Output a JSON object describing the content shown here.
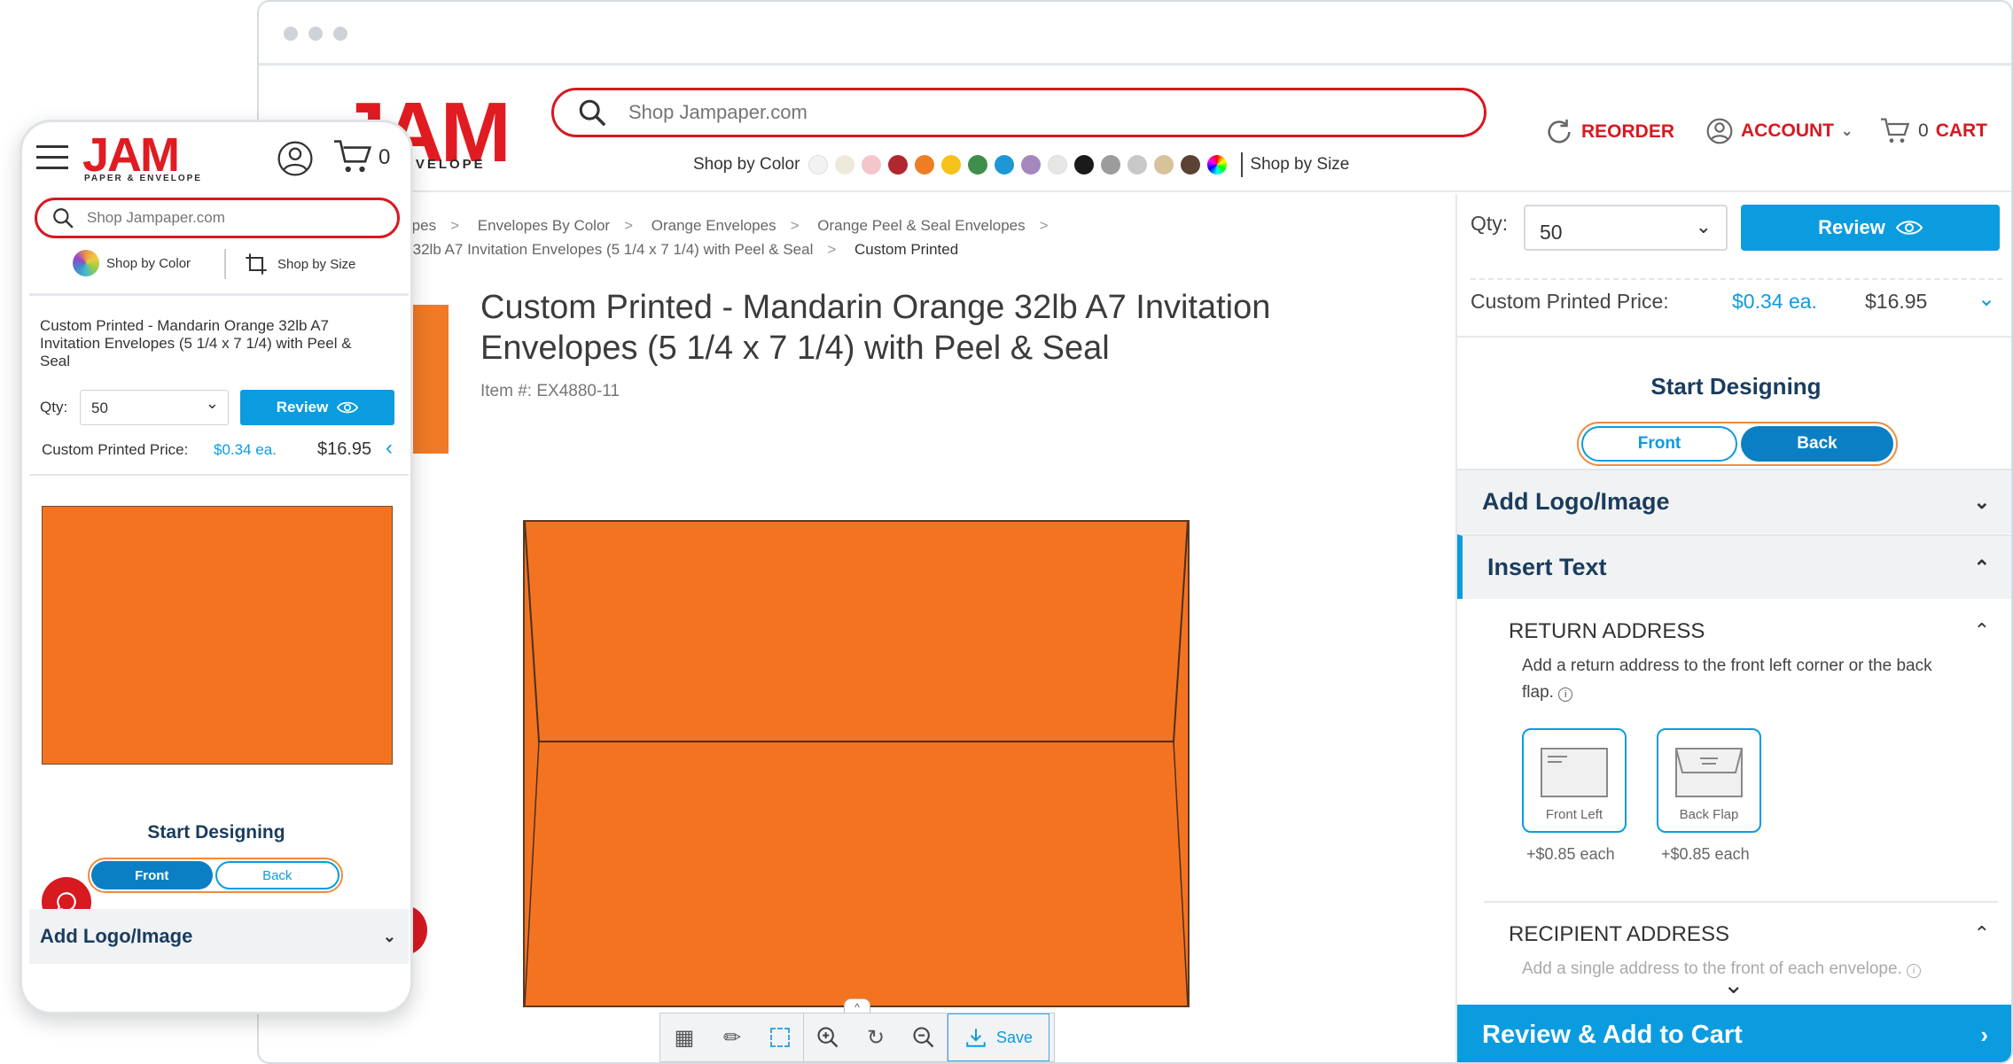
{
  "desktop": {
    "header": {
      "logo_main": "JAM",
      "logo_sub": "ENVELOPE",
      "search_placeholder": "Shop Jampaper.com",
      "shop_by_color": "Shop by Color",
      "shop_by_size": "Shop by Size",
      "swatches": [
        "#f2f2f2",
        "#eeeadb",
        "#f4c5cb",
        "#b0272f",
        "#ee7d26",
        "#f5c21b",
        "#3e8e4c",
        "#1f97d4",
        "#a487bf",
        "#e6e6e6",
        "#1a1a1a",
        "#9c9c9c",
        "#c8c8c8",
        "#d7c39a",
        "#5b4234"
      ],
      "reorder": "REORDER",
      "account": "ACCOUNT",
      "cart_count": "0",
      "cart": "CART"
    },
    "breadcrumb": [
      "elopes",
      "Envelopes By Color",
      "Orange Envelopes",
      "Orange Peel & Seal Envelopes"
    ],
    "breadcrumb_line2": "ge 32lb A7 Invitation Envelopes (5 1/4 x 7 1/4) with Peel & Seal",
    "breadcrumb_current": "Custom Printed",
    "product": {
      "title": "Custom Printed - Mandarin Orange 32lb A7 Invitation Envelopes (5 1/4 x 7 1/4) with Peel & Seal",
      "item_no": "Item #: EX4880-11",
      "envelope_color": "#f47321"
    },
    "toolbar": {
      "save": "Save"
    },
    "panel": {
      "qty_label": "Qty:",
      "qty_value": "50",
      "review": "Review",
      "price_label": "Custom Printed Price:",
      "price_each": "$0.34 ea.",
      "price_total": "$16.95",
      "start_designing": "Start Designing",
      "front": "Front",
      "back": "Back",
      "add_logo": "Add Logo/Image",
      "insert_text": "Insert Text",
      "return_address": "RETURN ADDRESS",
      "return_desc": "Add a return address to the front left corner or the back flap.",
      "opt_front_left": "Front Left",
      "opt_back_flap": "Back Flap",
      "opt_price_1": "+$0.85 each",
      "opt_price_2": "+$0.85 each",
      "recipient_address": "RECIPIENT ADDRESS",
      "recipient_desc": "Add a single address to the front of each envelope.",
      "review_add_cart": "Review & Add to Cart"
    }
  },
  "mobile": {
    "logo_main": "JAM",
    "logo_sub": "PAPER & ENVELOPE",
    "cart_count": "0",
    "search_placeholder": "Shop Jampaper.com",
    "shop_by_color": "Shop by Color",
    "shop_by_size": "Shop by Size",
    "title": "Custom Printed - Mandarin Orange 32lb A7 Invitation Envelopes (5 1/4 x 7 1/4) with Peel & Seal",
    "qty_label": "Qty:",
    "qty_value": "50",
    "review": "Review",
    "price_label": "Custom Printed Price:",
    "price_each": "$0.34 ea.",
    "price_total": "$16.95",
    "start_designing": "Start Designing",
    "front": "Front",
    "back": "Back",
    "add_logo": "Add Logo/Image"
  }
}
